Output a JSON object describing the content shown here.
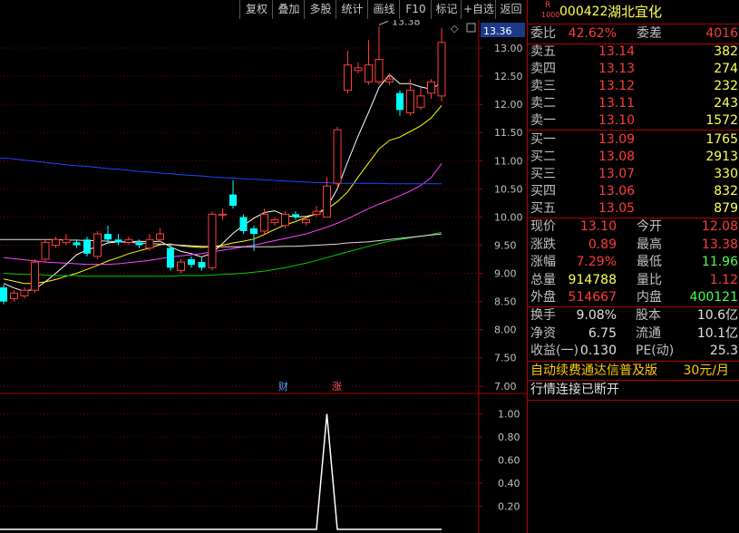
{
  "toolbar": {
    "buttons": [
      "复权",
      "叠加",
      "多股",
      "统计",
      "画线",
      "F10",
      "标记",
      "+自选",
      "返回"
    ]
  },
  "colors": {
    "up": "#ff3c3c",
    "down": "#00ffff",
    "ma5": "#ffffff",
    "ma10": "#ffff00",
    "ma20": "#ff44ff",
    "ma60": "#00cc00",
    "long1": "#2244ff",
    "long2": "#dddddd"
  },
  "main_chart": {
    "price_marker": "13.36",
    "high_label": "13.38",
    "y_ticks": [
      "13.00",
      "12.50",
      "12.00",
      "11.50",
      "11.00",
      "10.50",
      "10.00",
      "9.50",
      "9.00",
      "8.50",
      "8.00",
      "7.50",
      "7.00"
    ],
    "event_markers": {
      "cai": "财",
      "zhang": "涨"
    }
  },
  "sub_chart": {
    "y_ticks": [
      "1.00",
      "0.80",
      "0.60",
      "0.40",
      "0.20"
    ]
  },
  "chart_data": {
    "type": "candlestick",
    "ylim": [
      6.9,
      13.5
    ],
    "candles": [
      [
        8.75,
        8.5,
        8.8,
        8.45
      ],
      [
        8.55,
        8.65,
        8.7,
        8.5
      ],
      [
        8.6,
        8.7,
        8.75,
        8.55
      ],
      [
        8.7,
        9.2,
        9.25,
        8.65
      ],
      [
        9.25,
        9.55,
        9.6,
        9.2
      ],
      [
        9.5,
        9.6,
        9.65,
        9.45
      ],
      [
        9.55,
        9.6,
        9.7,
        9.5
      ],
      [
        9.55,
        9.5,
        9.6,
        9.45
      ],
      [
        9.6,
        9.35,
        9.65,
        9.3
      ],
      [
        9.3,
        9.7,
        9.75,
        9.25
      ],
      [
        9.7,
        9.6,
        9.85,
        9.55
      ],
      [
        9.6,
        9.55,
        9.7,
        9.5
      ],
      [
        9.55,
        9.6,
        9.65,
        9.5
      ],
      [
        9.55,
        9.5,
        9.6,
        9.45
      ],
      [
        9.45,
        9.6,
        9.7,
        9.4
      ],
      [
        9.6,
        9.7,
        9.8,
        9.55
      ],
      [
        9.45,
        9.1,
        9.5,
        9.05
      ],
      [
        9.05,
        9.2,
        9.25,
        9.0
      ],
      [
        9.25,
        9.15,
        9.3,
        9.1
      ],
      [
        9.2,
        9.1,
        9.3,
        9.05
      ],
      [
        9.1,
        10.05,
        10.1,
        9.05
      ],
      [
        10.05,
        10.05,
        10.15,
        9.95
      ],
      [
        10.4,
        10.2,
        10.65,
        10.15
      ],
      [
        10.0,
        9.75,
        10.05,
        9.7
      ],
      [
        9.8,
        9.7,
        9.85,
        9.4
      ],
      [
        9.75,
        10.05,
        10.15,
        9.7
      ],
      [
        9.9,
        9.95,
        10.0,
        9.85
      ],
      [
        9.85,
        10.05,
        10.1,
        9.8
      ],
      [
        10.05,
        10.0,
        10.1,
        9.95
      ],
      [
        9.9,
        9.95,
        10.0,
        9.85
      ],
      [
        10.05,
        10.1,
        10.2,
        10.0
      ],
      [
        10.0,
        10.55,
        10.7,
        10.0
      ],
      [
        10.6,
        11.55,
        11.6,
        10.55
      ],
      [
        12.25,
        12.7,
        12.95,
        12.2
      ],
      [
        12.6,
        12.65,
        12.75,
        12.55
      ],
      [
        12.4,
        12.7,
        13.15,
        12.35
      ],
      [
        12.4,
        12.8,
        13.38,
        12.35
      ],
      [
        12.4,
        12.45,
        12.55,
        12.35
      ],
      [
        12.2,
        11.9,
        12.25,
        11.8
      ],
      [
        11.85,
        12.25,
        12.45,
        11.8
      ],
      [
        11.95,
        12.15,
        12.3,
        11.9
      ],
      [
        12.2,
        12.4,
        12.45,
        12.1
      ],
      [
        12.15,
        13.1,
        13.36,
        12.05
      ]
    ],
    "series": [
      {
        "name": "MA5",
        "values": [
          8.82,
          8.74,
          8.68,
          8.72,
          8.85,
          9.0,
          9.16,
          9.33,
          9.42,
          9.47,
          9.54,
          9.56,
          9.56,
          9.57,
          9.56,
          9.57,
          9.47,
          9.39,
          9.35,
          9.29,
          9.36,
          9.53,
          9.71,
          9.85,
          9.98,
          10.08,
          10.11,
          10.03,
          10.0,
          10.01,
          10.05,
          10.17,
          10.5,
          10.98,
          11.44,
          11.86,
          12.3,
          12.53,
          12.37,
          12.37,
          12.31,
          12.27,
          12.39
        ]
      },
      {
        "name": "MA10",
        "values": [
          8.9,
          8.86,
          8.82,
          8.82,
          8.85,
          8.89,
          8.95,
          9.0,
          9.07,
          9.14,
          9.22,
          9.28,
          9.35,
          9.4,
          9.45,
          9.51,
          9.52,
          9.49,
          9.47,
          9.46,
          9.47,
          9.5,
          9.54,
          9.57,
          9.61,
          9.69,
          9.78,
          9.86,
          9.92,
          9.99,
          10.06,
          10.14,
          10.27,
          10.45,
          10.71,
          10.96,
          11.21,
          11.36,
          11.42,
          11.52,
          11.62,
          11.76,
          11.98
        ]
      },
      {
        "name": "MA20",
        "values": [
          9.28,
          9.26,
          9.24,
          9.22,
          9.2,
          9.19,
          9.18,
          9.17,
          9.16,
          9.16,
          9.16,
          9.17,
          9.19,
          9.21,
          9.23,
          9.26,
          9.29,
          9.31,
          9.33,
          9.35,
          9.38,
          9.41,
          9.44,
          9.47,
          9.5,
          9.54,
          9.58,
          9.62,
          9.66,
          9.7,
          9.76,
          9.82,
          9.89,
          9.97,
          10.06,
          10.15,
          10.23,
          10.3,
          10.38,
          10.46,
          10.56,
          10.7,
          10.95
        ]
      },
      {
        "name": "MA60",
        "values": [
          9.0,
          8.99,
          8.98,
          8.98,
          8.97,
          8.96,
          8.96,
          8.96,
          8.95,
          8.95,
          8.95,
          8.95,
          8.95,
          8.95,
          8.95,
          8.95,
          8.95,
          8.96,
          8.96,
          8.96,
          8.97,
          8.98,
          8.99,
          9.0,
          9.02,
          9.04,
          9.07,
          9.1,
          9.14,
          9.18,
          9.23,
          9.28,
          9.33,
          9.38,
          9.43,
          9.48,
          9.53,
          9.57,
          9.6,
          9.63,
          9.66,
          9.69,
          9.73
        ]
      },
      {
        "name": "MA120",
        "values": [
          9.6,
          9.6,
          9.6,
          9.6,
          9.6,
          9.6,
          9.59,
          9.59,
          9.58,
          9.58,
          9.57,
          9.56,
          9.55,
          9.54,
          9.53,
          9.52,
          9.51,
          9.5,
          9.49,
          9.48,
          9.47,
          9.47,
          9.47,
          9.47,
          9.47,
          9.47,
          9.47,
          9.48,
          9.48,
          9.49,
          9.5,
          9.51,
          9.52,
          9.54,
          9.55,
          9.56,
          9.58,
          9.6,
          9.62,
          9.64,
          9.66,
          9.68,
          9.7
        ]
      },
      {
        "name": "MA250",
        "values": [
          11.05,
          11.03,
          11.01,
          10.99,
          10.97,
          10.95,
          10.93,
          10.91,
          10.9,
          10.88,
          10.86,
          10.85,
          10.83,
          10.81,
          10.8,
          10.78,
          10.77,
          10.75,
          10.74,
          10.73,
          10.71,
          10.7,
          10.69,
          10.68,
          10.67,
          10.66,
          10.65,
          10.64,
          10.63,
          10.62,
          10.61,
          10.61,
          10.6,
          10.6,
          10.6,
          10.6,
          10.6,
          10.59,
          10.59,
          10.59,
          10.59,
          10.59,
          10.59
        ]
      }
    ],
    "indicator": {
      "values_note": "spike",
      "spike_index": 29,
      "spike_value": 1.0,
      "ylim": [
        0,
        1.1
      ]
    }
  },
  "panel": {
    "code": "000422",
    "name": "湖北宜化",
    "r_badge": "R",
    "r_sub": "1000",
    "weibi_label": "委比",
    "weibi": "42.62%",
    "weicha_label": "委差",
    "weicha": "4016",
    "asks": [
      {
        "label": "卖五",
        "price": "13.14",
        "vol": "382"
      },
      {
        "label": "卖四",
        "price": "13.13",
        "vol": "274"
      },
      {
        "label": "卖三",
        "price": "13.12",
        "vol": "232"
      },
      {
        "label": "卖二",
        "price": "13.11",
        "vol": "243"
      },
      {
        "label": "卖一",
        "price": "13.10",
        "vol": "1572"
      }
    ],
    "bids": [
      {
        "label": "买一",
        "price": "13.09",
        "vol": "1765"
      },
      {
        "label": "买二",
        "price": "13.08",
        "vol": "2913"
      },
      {
        "label": "买三",
        "price": "13.07",
        "vol": "330"
      },
      {
        "label": "买四",
        "price": "13.06",
        "vol": "832"
      },
      {
        "label": "买五",
        "price": "13.05",
        "vol": "879"
      }
    ],
    "stats": [
      {
        "l1": "现价",
        "v1": "13.10",
        "l2": "今开",
        "v2": "12.08",
        "c1": "red",
        "c2": "red"
      },
      {
        "l1": "涨跌",
        "v1": "0.89",
        "l2": "最高",
        "v2": "13.38",
        "c1": "red",
        "c2": "red"
      },
      {
        "l1": "涨幅",
        "v1": "7.29%",
        "l2": "最低",
        "v2": "11.96",
        "c1": "red",
        "c2": "green"
      },
      {
        "l1": "总量",
        "v1": "914788",
        "l2": "量比",
        "v2": "1.12",
        "c1": "yellow",
        "c2": "red"
      },
      {
        "l1": "外盘",
        "v1": "514667",
        "l2": "内盘",
        "v2": "400121",
        "c1": "red",
        "c2": "green"
      }
    ],
    "fund": [
      {
        "l1": "换手",
        "v1": "9.08%",
        "l2": "股本",
        "v2": "10.6亿"
      },
      {
        "l1": "净资",
        "v1": "6.75",
        "l2": "流通",
        "v2": "10.1亿"
      },
      {
        "l1": "收益(一)",
        "v1": "0.130",
        "l2": "PE(动)",
        "v2": "25.3"
      }
    ],
    "ad_text": "自动续费通达信普及版",
    "ad_price": "30元/月",
    "status": "行情连接已断开"
  }
}
